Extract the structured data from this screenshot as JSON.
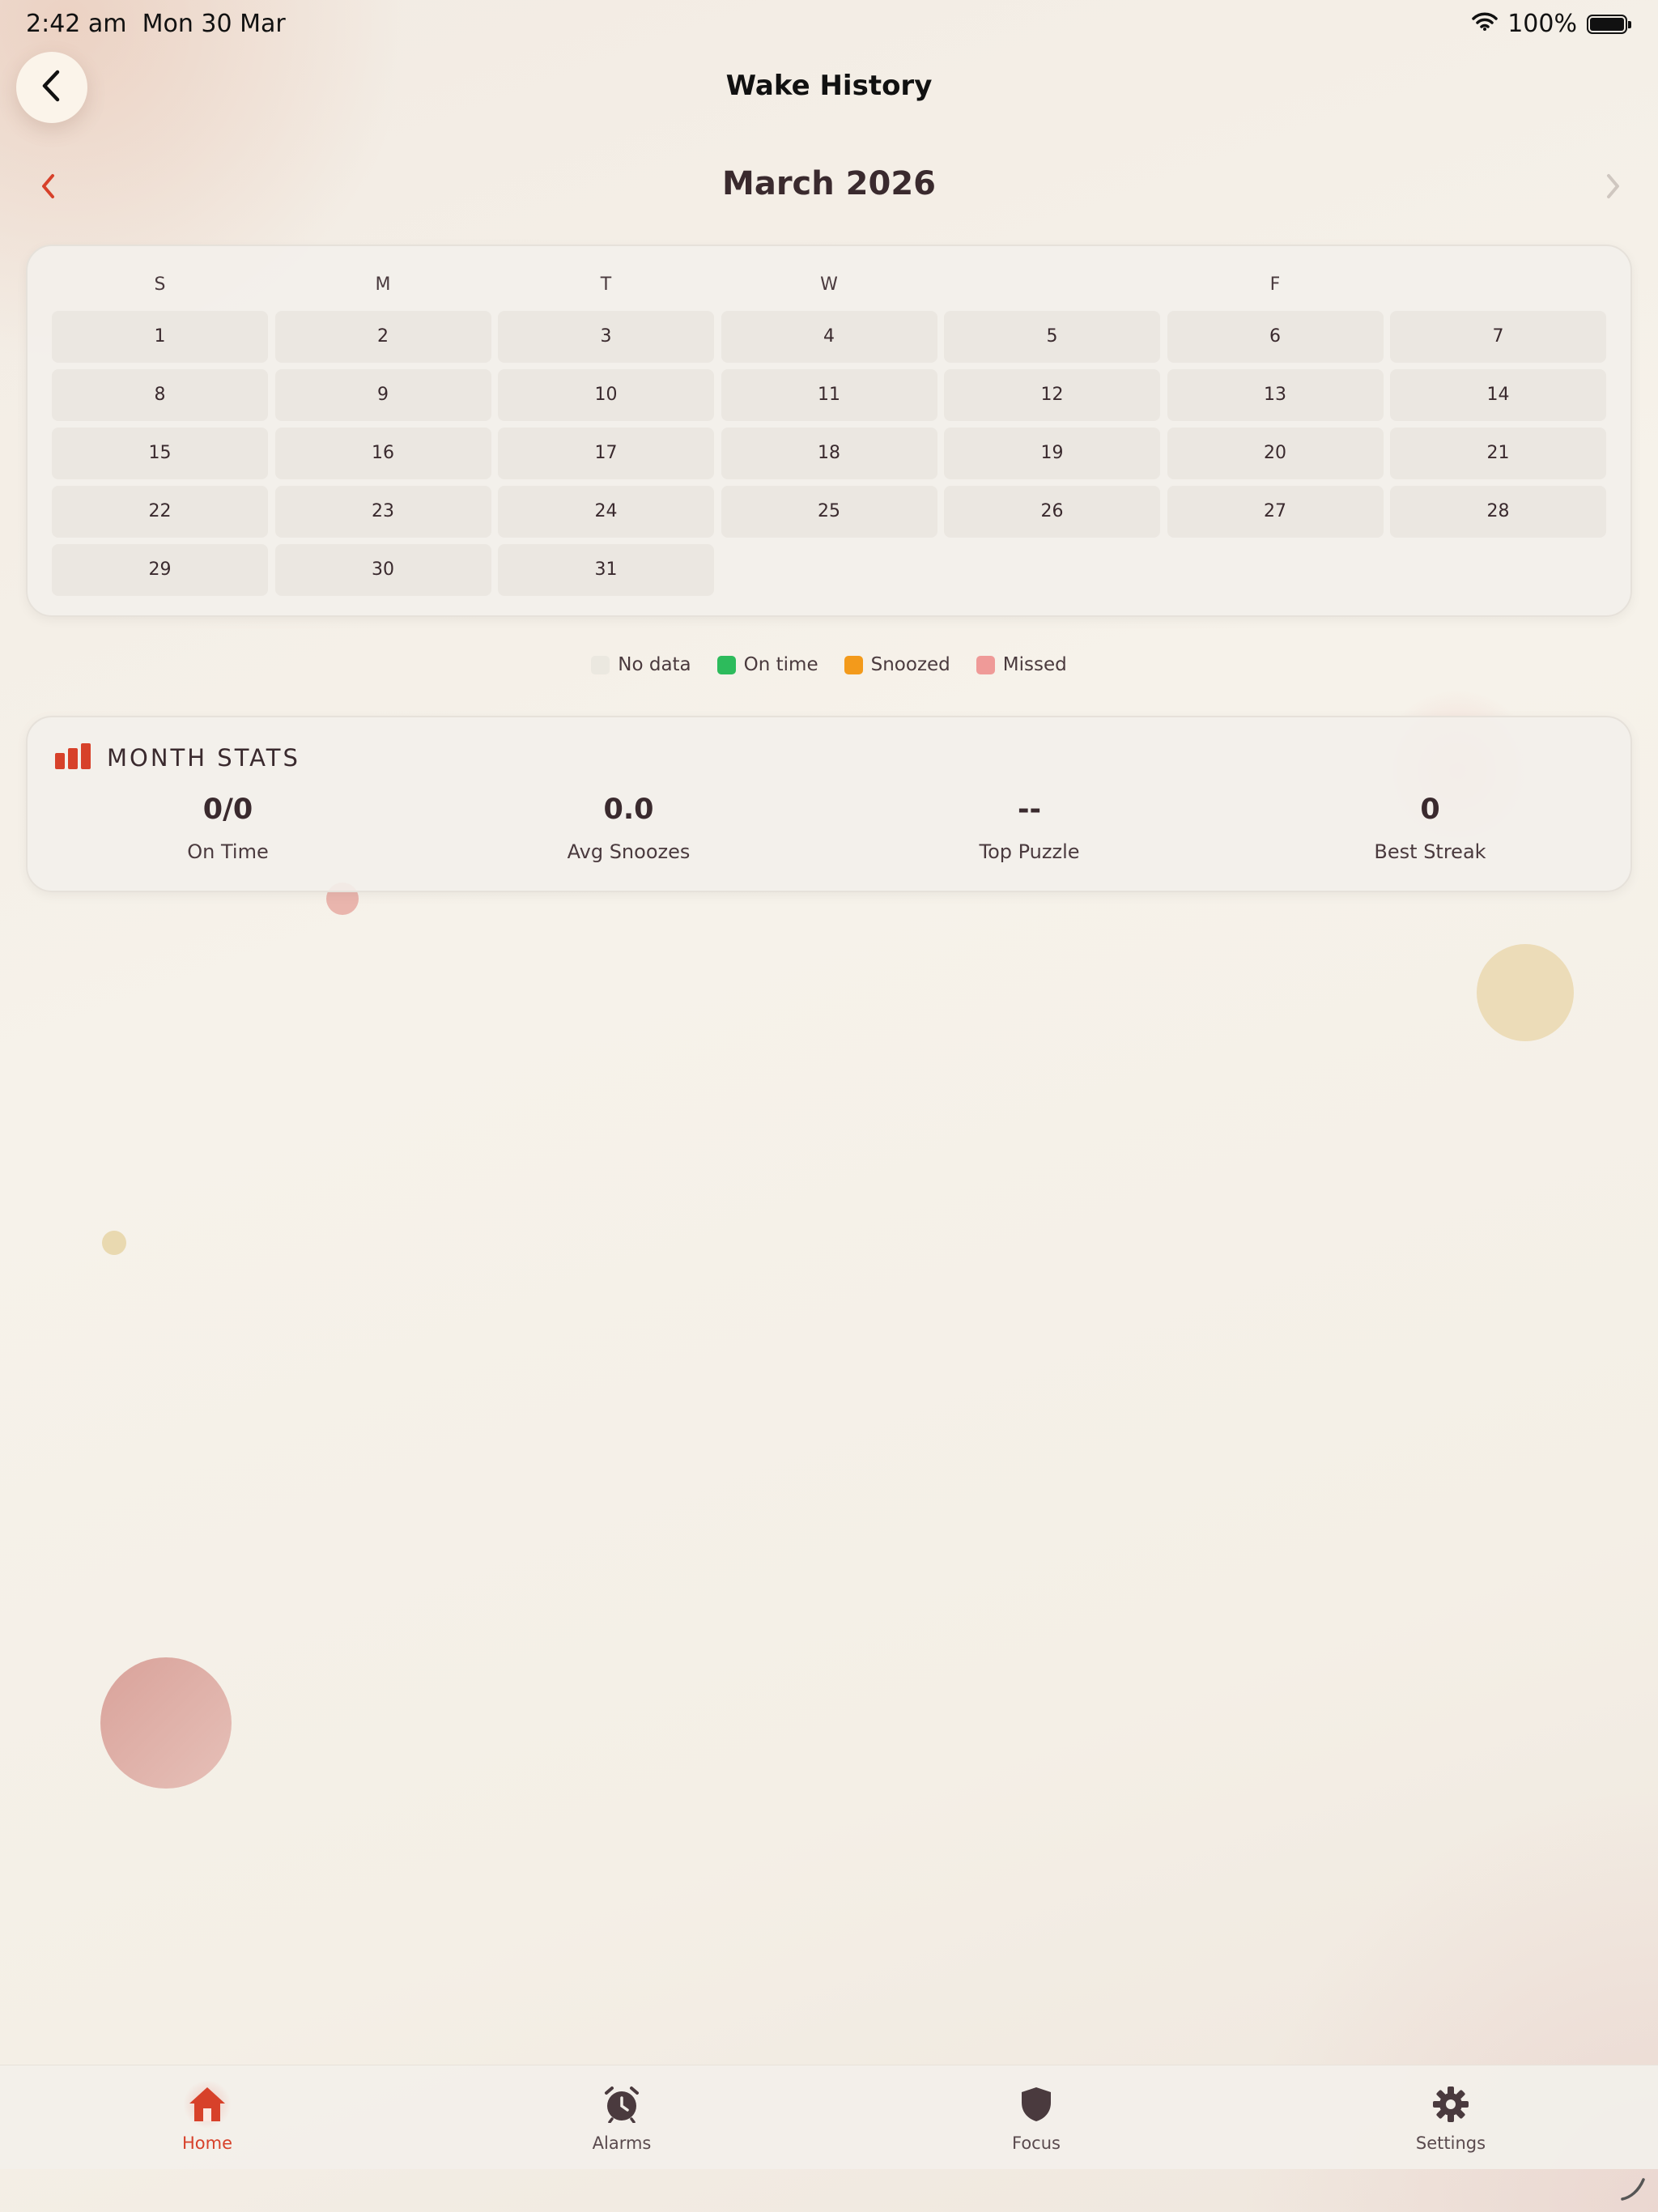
{
  "status_bar": {
    "time": "2:42 am",
    "date": "Mon 30 Mar",
    "battery": "100%"
  },
  "header": {
    "title": "Wake History",
    "back_icon": "chevron-left-icon"
  },
  "calendar": {
    "month_title": "March 2026",
    "weekdays": [
      "S",
      "M",
      "T",
      "W",
      "",
      "F",
      ""
    ],
    "days": [
      "1",
      "2",
      "3",
      "4",
      "5",
      "6",
      "7",
      "8",
      "9",
      "10",
      "11",
      "12",
      "13",
      "14",
      "15",
      "16",
      "17",
      "18",
      "19",
      "20",
      "21",
      "22",
      "23",
      "24",
      "25",
      "26",
      "27",
      "28",
      "29",
      "30",
      "31"
    ]
  },
  "legend": [
    {
      "label": "No data",
      "color": "#ebe8e0"
    },
    {
      "label": "On time",
      "color": "#2dbb5c"
    },
    {
      "label": "Snoozed",
      "color": "#f39a1b"
    },
    {
      "label": "Missed",
      "color": "#ef9a98"
    }
  ],
  "month_stats": {
    "title": "MONTH STATS",
    "icon": "bar-chart-icon",
    "items": [
      {
        "value": "0/0",
        "label": "On Time"
      },
      {
        "value": "0.0",
        "label": "Avg Snoozes"
      },
      {
        "value": "--",
        "label": "Top Puzzle"
      },
      {
        "value": "0",
        "label": "Best Streak"
      }
    ]
  },
  "tabs": [
    {
      "label": "Home",
      "icon": "home-icon",
      "active": true
    },
    {
      "label": "Alarms",
      "icon": "alarm-clock-icon",
      "active": false
    },
    {
      "label": "Focus",
      "icon": "shield-icon",
      "active": false
    },
    {
      "label": "Settings",
      "icon": "gear-icon",
      "active": false
    }
  ],
  "colors": {
    "accent": "#d7412a",
    "text": "#3a2a2e",
    "cell": "#ebe7e1"
  }
}
